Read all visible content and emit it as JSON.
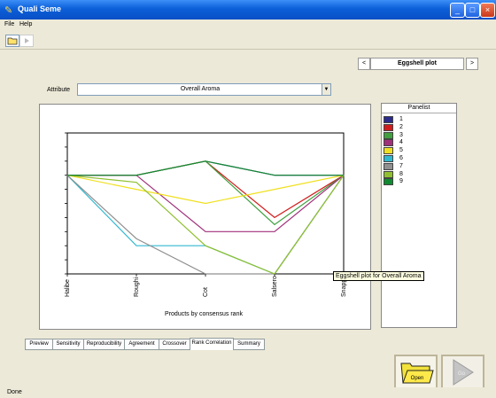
{
  "window": {
    "title": "Quali Seme",
    "min_label": "_",
    "max_label": "□",
    "close_label": "×"
  },
  "menu": {
    "file": "File",
    "help": "Help"
  },
  "page_selector": {
    "prev_label": "<",
    "value": "Eggshell plot",
    "next_label": ">"
  },
  "attribute": {
    "label": "Attribute",
    "value": "Overall Aroma"
  },
  "chart_data": {
    "type": "line",
    "title": "",
    "xlabel": "Products by consensus rank",
    "ylabel": "",
    "categories": [
      "Halibe",
      "Roughi",
      "Cot",
      "Salsero",
      "Snapp"
    ],
    "ylim": [
      0,
      10
    ],
    "series": [
      {
        "name": "1",
        "color": "#2b2b8c",
        "values": [
          3,
          3,
          2,
          3,
          3
        ]
      },
      {
        "name": "2",
        "color": "#d11c1c",
        "values": [
          3,
          3,
          2,
          6,
          3
        ]
      },
      {
        "name": "3",
        "color": "#40a040",
        "values": [
          3,
          3,
          2,
          6.5,
          3
        ]
      },
      {
        "name": "4",
        "color": "#a0307a",
        "values": [
          3,
          3,
          7,
          7,
          3
        ]
      },
      {
        "name": "5",
        "color": "#f0e020",
        "values": [
          3,
          4,
          5,
          4,
          3
        ]
      },
      {
        "name": "6",
        "color": "#30b8d0",
        "values": [
          3,
          8,
          8,
          10,
          3
        ]
      },
      {
        "name": "7",
        "color": "#909090",
        "values": [
          3,
          7.5,
          10,
          10,
          3
        ]
      },
      {
        "name": "8",
        "color": "#90c030",
        "values": [
          3,
          3.5,
          8,
          10,
          3
        ]
      },
      {
        "name": "9",
        "color": "#108a30",
        "values": [
          3,
          3,
          2,
          3,
          3
        ]
      }
    ]
  },
  "legend": {
    "header": "Panelist",
    "items": [
      "1",
      "2",
      "3",
      "4",
      "5",
      "6",
      "7",
      "8",
      "9"
    ]
  },
  "tooltip": "Eggshell plot for Overall Aroma",
  "tabs": [
    {
      "label": "Preview"
    },
    {
      "label": "Sensitivity"
    },
    {
      "label": "Reproducibility"
    },
    {
      "label": "Agreement"
    },
    {
      "label": "Crossover"
    },
    {
      "label": "Rank Correlation"
    },
    {
      "label": "Summary"
    }
  ],
  "buttons": {
    "open_label": "Open",
    "go_label": "Go"
  },
  "status": "Done"
}
